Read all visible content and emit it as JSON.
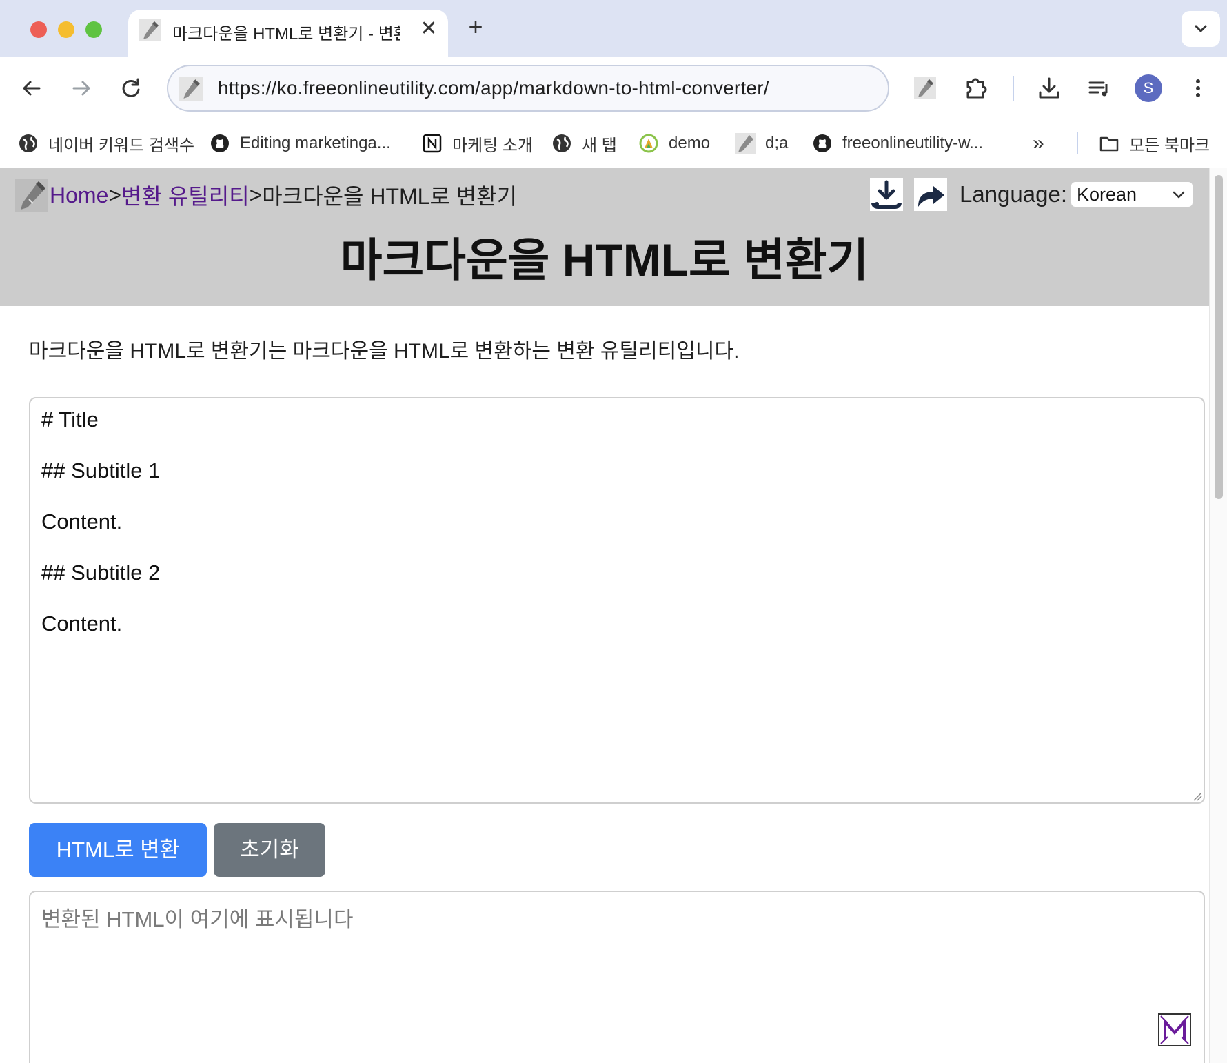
{
  "browser": {
    "tab": {
      "title": "마크다운을 HTML로 변환기 - 변환",
      "close_glyph": "✕"
    },
    "new_tab_glyph": "+",
    "address_bar": {
      "url": "https://ko.freeonlineutility.com/app/markdown-to-html-converter/"
    },
    "profile_initial": "S",
    "bookmarks": [
      {
        "label": "네이버 키워드 검색수",
        "icon": "globe-icon"
      },
      {
        "label": "Editing marketinga...",
        "icon": "github-icon"
      },
      {
        "label": "마케팅 소개",
        "icon": "notion-icon"
      },
      {
        "label": "새 탭",
        "icon": "globe-icon"
      },
      {
        "label": "demo",
        "icon": "app-icon"
      },
      {
        "label": "d;a",
        "icon": "wrench-icon"
      },
      {
        "label": "freeonlineutility-w...",
        "icon": "github-icon"
      }
    ],
    "bookmarks_overflow": "»",
    "all_bookmarks": "모든 북마크"
  },
  "header": {
    "breadcrumb": {
      "home": "Home",
      "sep1": ">",
      "category": "변환 유틸리티",
      "sep2": ">",
      "current": " 마크다운을 HTML로 변환기"
    },
    "language_label": "Language:",
    "language_value": "Korean",
    "title": "마크다운을 HTML로 변환기"
  },
  "main": {
    "description": "마크다운을 HTML로 변환기는 마크다운을 HTML로 변환하는 변환 유틸리티입니다.",
    "markdown_input": "# Title\n\n## Subtitle 1\n\nContent.\n\n## Subtitle 2\n\nContent.",
    "convert_button": "HTML로 변환",
    "reset_button": "초기화",
    "output_placeholder": "변환된 HTML이 여기에 표시됩니다"
  },
  "colors": {
    "header_bg": "#cccccc",
    "link_visited": "#551a8b",
    "convert_button": "#3b82f6",
    "reset_button": "#6c757d"
  }
}
